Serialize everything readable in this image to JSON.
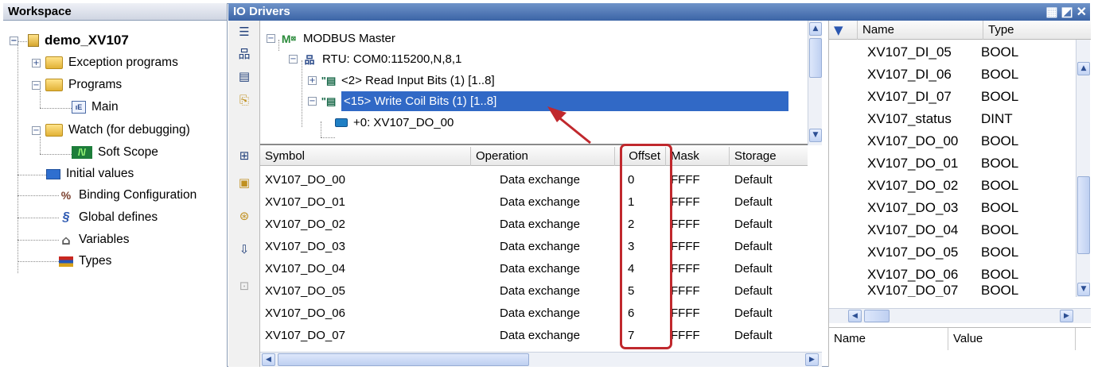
{
  "workspace": {
    "title": "Workspace",
    "project": "demo_XV107",
    "items": [
      {
        "label": "Exception programs",
        "icon": "folder-icon"
      },
      {
        "label": "Programs",
        "icon": "folder-icon"
      },
      {
        "label": "Main",
        "icon": "program-icon"
      },
      {
        "label": "Watch (for debugging)",
        "icon": "folder-icon"
      },
      {
        "label": "Soft Scope",
        "icon": "scope-icon"
      },
      {
        "label": "Initial values",
        "icon": "table-icon"
      },
      {
        "label": "Binding Configuration",
        "icon": "binding-icon"
      },
      {
        "label": "Global defines",
        "icon": "define-icon"
      },
      {
        "label": "Variables",
        "icon": "home-icon"
      },
      {
        "label": "Types",
        "icon": "types-icon"
      }
    ]
  },
  "io_drivers": {
    "title": "IO Drivers",
    "tree": {
      "master": "MODBUS Master",
      "rtu": "RTU: COM0:115200,N,8,1",
      "read_bits": "<2> Read Input Bits (1) [1..8]",
      "write_coils": "<15> Write Coil Bits (1) [1..8]",
      "offset_item": "+0: XV107_DO_00"
    },
    "table": {
      "headers": [
        "Symbol",
        "Operation",
        "Offset",
        "Mask",
        "Storage"
      ],
      "rows": [
        [
          "XV107_DO_00",
          "Data exchange",
          "0",
          "FFFF",
          "Default"
        ],
        [
          "XV107_DO_01",
          "Data exchange",
          "1",
          "FFFF",
          "Default"
        ],
        [
          "XV107_DO_02",
          "Data exchange",
          "2",
          "FFFF",
          "Default"
        ],
        [
          "XV107_DO_03",
          "Data exchange",
          "3",
          "FFFF",
          "Default"
        ],
        [
          "XV107_DO_04",
          "Data exchange",
          "4",
          "FFFF",
          "Default"
        ],
        [
          "XV107_DO_05",
          "Data exchange",
          "5",
          "FFFF",
          "Default"
        ],
        [
          "XV107_DO_06",
          "Data exchange",
          "6",
          "FFFF",
          "Default"
        ],
        [
          "XV107_DO_07",
          "Data exchange",
          "7",
          "FFFF",
          "Default"
        ]
      ]
    }
  },
  "variables": {
    "headers": [
      "Name",
      "Type"
    ],
    "rows": [
      [
        "XV107_DI_05",
        "BOOL"
      ],
      [
        "XV107_DI_06",
        "BOOL"
      ],
      [
        "XV107_DI_07",
        "BOOL"
      ],
      [
        "XV107_status",
        "DINT"
      ],
      [
        "XV107_DO_00",
        "BOOL"
      ],
      [
        "XV107_DO_01",
        "BOOL"
      ],
      [
        "XV107_DO_02",
        "BOOL"
      ],
      [
        "XV107_DO_03",
        "BOOL"
      ],
      [
        "XV107_DO_04",
        "BOOL"
      ],
      [
        "XV107_DO_05",
        "BOOL"
      ],
      [
        "XV107_DO_06",
        "BOOL"
      ],
      [
        "XV107_DO_07",
        "BOOL"
      ]
    ],
    "bottom_headers": [
      "Name",
      "Value"
    ]
  },
  "colors": {
    "selection": "#3169c6",
    "title_bar": "#3b64a6",
    "annotation": "#c0282d"
  }
}
